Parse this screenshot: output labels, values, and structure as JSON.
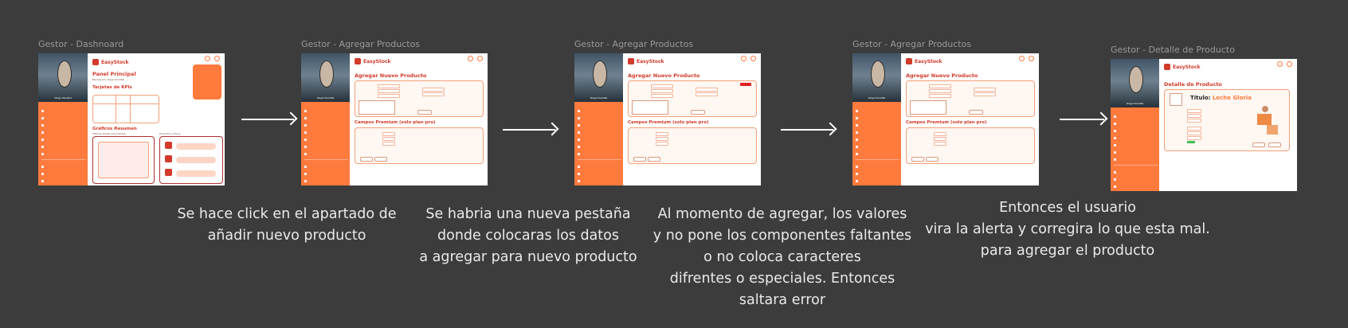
{
  "frames": [
    {
      "title": "Gestor - Dashnoard"
    },
    {
      "title": "Gestor - Agregar Productos"
    },
    {
      "title": "Gestor - Agregar Productos"
    },
    {
      "title": "Gestor - Agregar Productos"
    },
    {
      "title": "Gestor - Detalle de Producto"
    }
  ],
  "app": {
    "brand": "EasyStock",
    "user": "Diego Penafiel"
  },
  "dashboard": {
    "heading": "Panel Principal",
    "subheading": "Bienvenido, Diego Penafiel",
    "kpi_title": "Tarjetas de KPIs",
    "charts_title": "Gráficos Resumen",
    "recent_title": "Últimas alertas importantes",
    "critical_title": "Productos críticos"
  },
  "add": {
    "heading": "Agregar Nuevo Producto",
    "premium": "Campos Premium (solo plan pro)"
  },
  "detail": {
    "heading": "Detalle de Producto",
    "title_label": "Título:",
    "title_value": "Leche Gloria"
  },
  "captions": {
    "c1": [
      "Se hace click en el apartado de",
      "añadir nuevo producto"
    ],
    "c2": [
      "Se habria una nueva pestaña",
      "donde colocaras los datos",
      "a agregar para nuevo producto"
    ],
    "c3": [
      "Al momento de agregar, los valores",
      "y no pone los componentes faltantes",
      "o no coloca caracteres",
      "difrentes o especiales. Entonces",
      "saltara error"
    ],
    "c4": [
      "Entonces el usuario",
      "vira la alerta y corregira lo que esta mal.",
      "para agregar el producto"
    ]
  },
  "colors": {
    "background": "#3c3c3c",
    "accent": "#ff7a3d",
    "brand_red": "#d23a2a"
  }
}
